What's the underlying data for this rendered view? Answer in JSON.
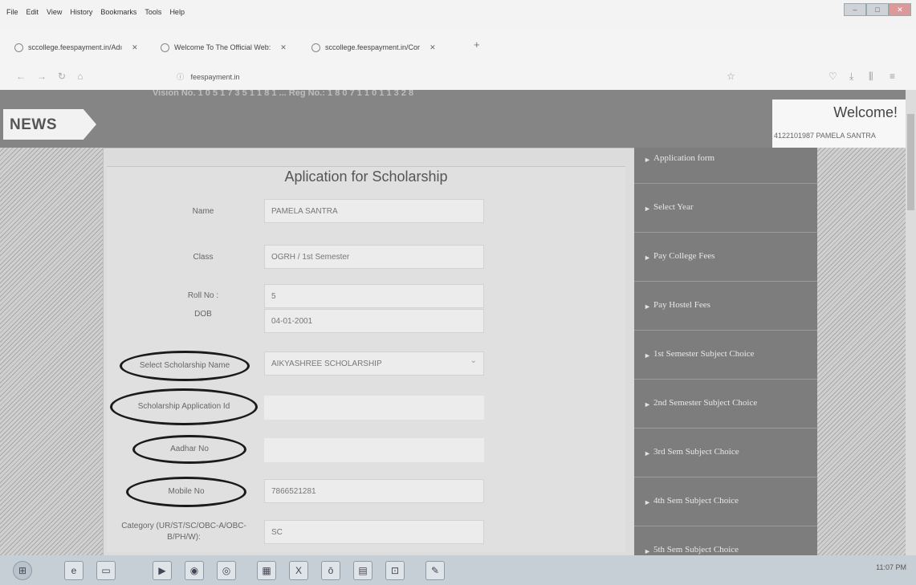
{
  "menubar": {
    "items": [
      "File",
      "Edit",
      "View",
      "History",
      "Bookmarks",
      "Tools",
      "Help"
    ]
  },
  "tabs": [
    {
      "label": "sccollege.feespayment.in/Adı"
    },
    {
      "label": "Welcome To The Official Web:"
    },
    {
      "label": "sccollege.feespayment.in/Cor"
    }
  ],
  "url": {
    "text": "feespayment.in"
  },
  "header": {
    "news": "NEWS",
    "welcome": "Welcome!",
    "user": "4122101987 PAMELA SANTRA",
    "faded_text": "Vision No. 1 0 5 1 7 3 5 1 1 8 1 ... Reg No.: 1 8 0 7 1 1 0 1 1 3 2 8"
  },
  "form": {
    "title": "Aplication for Scholarship",
    "fields": [
      {
        "label": "Name",
        "value": "PAMELA SANTRA"
      },
      {
        "label": "Class",
        "value": "OGRH / 1st Semester"
      },
      {
        "label": "Roll No :",
        "value": "5"
      },
      {
        "label": "DOB",
        "value": "04-01-2001"
      },
      {
        "label": "Select Scholarship Name",
        "value": "AIKYASHREE SCHOLARSHIP"
      },
      {
        "label": "Scholarship Application Id",
        "value": ""
      },
      {
        "label": "Aadhar No",
        "value": ""
      },
      {
        "label": "Mobile No",
        "value": "7866521281"
      },
      {
        "label": "Category (UR/ST/SC/OBC-A/OBC-B/PH/W):",
        "value": "SC"
      }
    ]
  },
  "sidebar": {
    "items": [
      {
        "label": "Application form"
      },
      {
        "label": "Select Year"
      },
      {
        "label": "Pay College Fees"
      },
      {
        "label": "Pay Hostel Fees"
      },
      {
        "label": "1st Semester Subject Choice"
      },
      {
        "label": "2nd Semester Subject Choice"
      },
      {
        "label": "3rd Sem Subject Choice"
      },
      {
        "label": "4th Sem Subject Choice"
      },
      {
        "label": "5th Sem Subject Choice"
      }
    ]
  },
  "tray": {
    "time": "11:07 PM"
  }
}
